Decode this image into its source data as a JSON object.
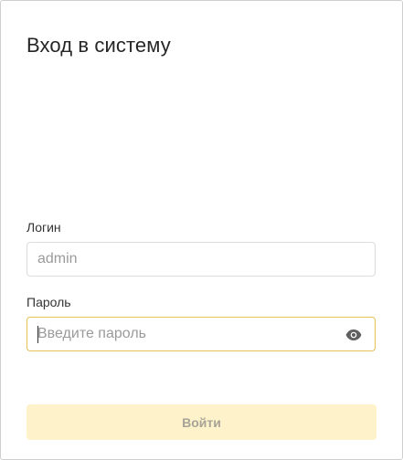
{
  "form": {
    "title": "Вход в систему",
    "login_label": "Логин",
    "login_value": "admin",
    "password_label": "Пароль",
    "password_placeholder": "Введите пароль",
    "password_value": "",
    "submit_label": "Войти",
    "toggle_visibility_icon": "eye-icon"
  },
  "colors": {
    "focus_border": "#e3c257",
    "submit_bg_disabled": "#fdf2c9",
    "submit_text_disabled": "#a8a397"
  }
}
